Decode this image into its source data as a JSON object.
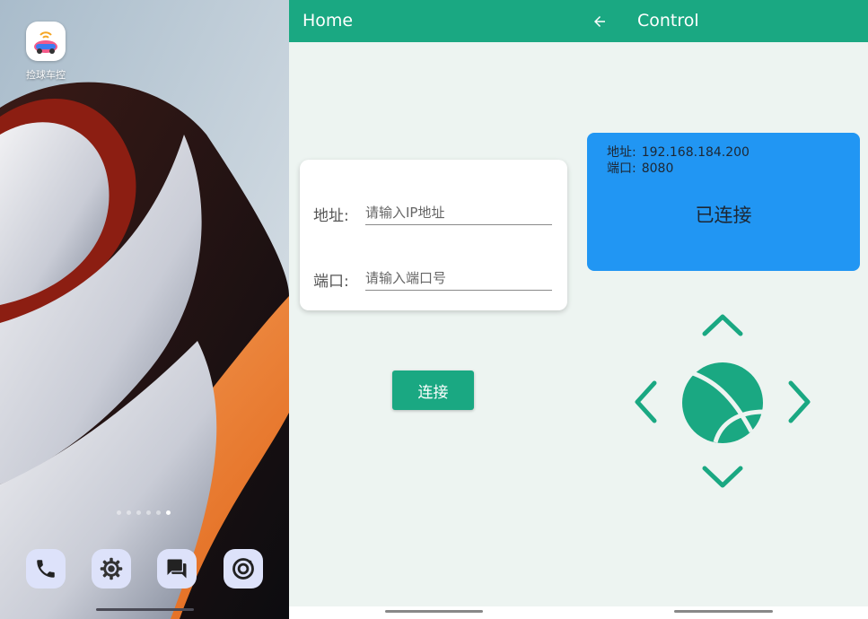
{
  "launcher": {
    "app_name": "捡球车控",
    "page_count": 6,
    "active_page_index": 5,
    "dock": [
      "phone-icon",
      "settings-icon",
      "messages-icon",
      "camera-icon"
    ]
  },
  "home": {
    "title": "Home",
    "address_label": "地址:",
    "address_placeholder": "请输入IP地址",
    "port_label": "端口:",
    "port_placeholder": "请输入端口号",
    "connect_label": "连接"
  },
  "control": {
    "title": "Control",
    "address_label": "地址:",
    "address_value": "192.168.184.200",
    "port_label": "端口:",
    "port_value": "8080",
    "status": "已连接"
  },
  "colors": {
    "primary": "#1aa882",
    "status_card": "#2196f3",
    "background": "#edf4f1"
  }
}
